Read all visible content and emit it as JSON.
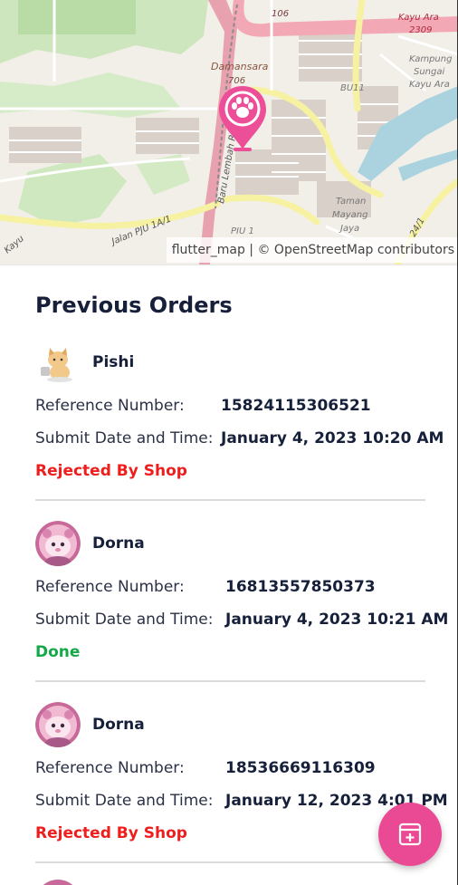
{
  "map": {
    "attribution": "flutter_map | © OpenStreetMap contributors",
    "labels": {
      "damansara": "Damansara",
      "route_706": "706",
      "route_106": "106",
      "kayu_ara": "Kayu Ara",
      "route_2309": "2309",
      "kampung": "Kampung",
      "sungai": "Sungai",
      "kayu_ara_2": "Kayu Ara",
      "bu11": "BU11",
      "taman": "Taman",
      "mayang": "Mayang",
      "jaya": "Jaya",
      "piu1": "PIU 1",
      "jalan_piu": "Jalan PJU 1A/1",
      "lembah_ria": "Baru Lembah Ria",
      "kayu": "Kayu",
      "jalan_24": "24/1"
    },
    "marker_icon": "paw-icon"
  },
  "section_title": "Previous Orders",
  "orders": [
    {
      "shop_name": "Pishi",
      "avatar": "cat-avatar",
      "reference_label": "Reference Number:",
      "reference_value": "15824115306521",
      "date_label": "Submit Date and Time:",
      "date_value": "January 4, 2023  10:20 AM",
      "status": "Rejected By Shop"
    },
    {
      "shop_name": "Dorna",
      "avatar": "bear-avatar",
      "reference_label": "Reference Number:",
      "reference_value": "16813557850373",
      "date_label": "Submit Date and Time:",
      "date_value": "January 4, 2023  10:21 AM",
      "status": "Done"
    },
    {
      "shop_name": "Dorna",
      "avatar": "bear-avatar",
      "reference_label": "Reference Number:",
      "reference_value": "18536669116309",
      "date_label": "Submit Date and Time:",
      "date_value": "January 12, 2023  4:01 PM",
      "status": "Rejected By Shop"
    }
  ],
  "fab_icon": "add-order-icon",
  "colors": {
    "accent": "#ea4a94",
    "rejected": "#f01d1d",
    "done": "#14a84a",
    "text": "#16203a"
  }
}
